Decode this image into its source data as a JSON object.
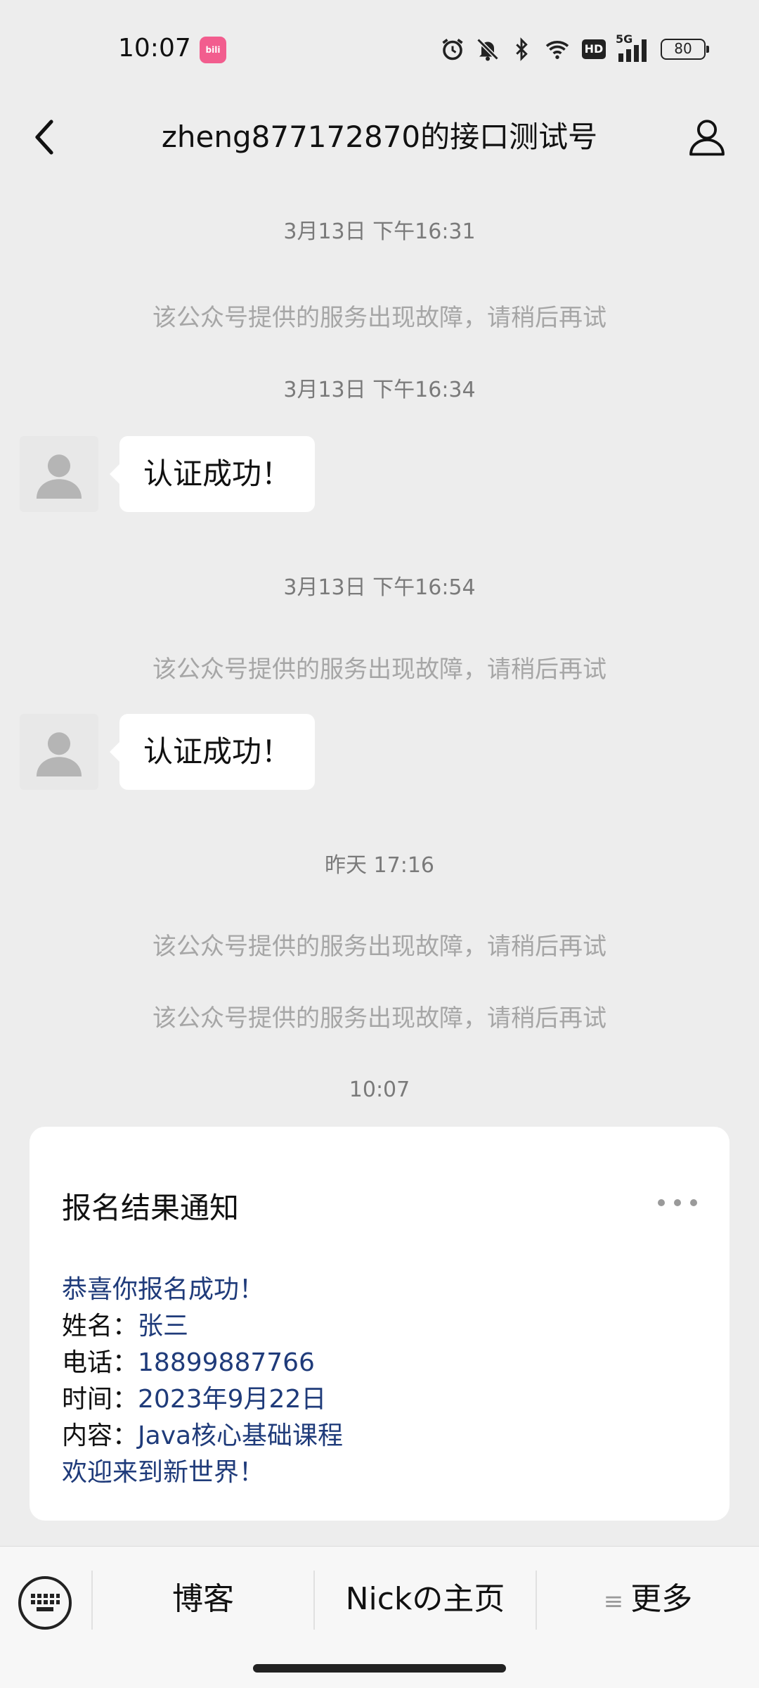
{
  "status_bar": {
    "time": "10:07",
    "app_badge": "bili",
    "network": "5G",
    "hd": "HD",
    "battery": "80",
    "icons": [
      "alarm-icon",
      "mute-icon",
      "bluetooth-icon",
      "wifi-icon",
      "hd-icon",
      "signal-icon",
      "battery-icon"
    ]
  },
  "header": {
    "title": "zheng877172870的接口测试号",
    "back_icon": "chevron-left-icon",
    "profile_icon": "person-icon"
  },
  "chat": {
    "ts1": "3月13日 下午16:31",
    "sys1": "该公众号提供的服务出现故障，请稍后再试",
    "ts2": "3月13日 下午16:34",
    "msg1": "认证成功！",
    "ts3": "3月13日 下午16:54",
    "sys2": "该公众号提供的服务出现故障，请稍后再试",
    "msg2": "认证成功！",
    "ts4": "昨天 17:16",
    "sys3": "该公众号提供的服务出现故障，请稍后再试",
    "sys4": "该公众号提供的服务出现故障，请稍后再试",
    "ts5": "10:07"
  },
  "card": {
    "title": "报名结果通知",
    "greeting": "恭喜你报名成功！",
    "name_label": "姓名：",
    "name_value": "张三",
    "phone_label": "电话：",
    "phone_value": "18899887766",
    "time_label": "时间：",
    "time_value": "2023年9月22日",
    "content_label": "内容：",
    "content_value": "Java核心基础课程",
    "closing": "欢迎来到新世界！"
  },
  "bottom_menu": {
    "keyboard_icon": "keyboard-icon",
    "item1": "博客",
    "item2": "Nickの主页",
    "item3_icon": "≡",
    "item3": "更多"
  },
  "colors": {
    "background": "#ededed",
    "bubble": "#ffffff",
    "card_text_blue": "#1f3b7a",
    "system_text": "#a6a6a6"
  }
}
